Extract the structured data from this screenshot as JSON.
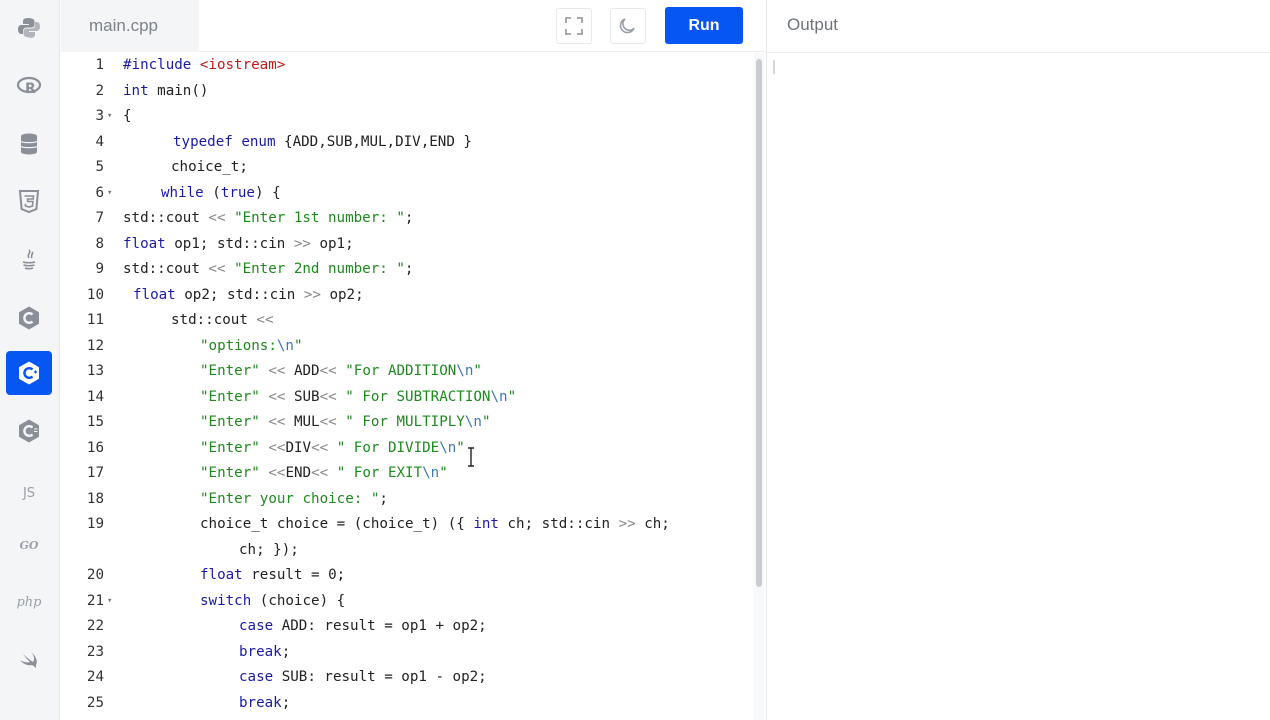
{
  "sidebar": {
    "languages": [
      {
        "name": "python",
        "icon": "python-icon"
      },
      {
        "name": "r",
        "icon": "r-icon"
      },
      {
        "name": "sql",
        "icon": "database-icon"
      },
      {
        "name": "html",
        "icon": "html5-icon"
      },
      {
        "name": "java",
        "icon": "java-icon"
      },
      {
        "name": "c",
        "icon": "c-icon"
      },
      {
        "name": "cpp",
        "icon": "cpp-icon",
        "active": true
      },
      {
        "name": "csharp",
        "icon": "csharp-icon"
      },
      {
        "name": "javascript",
        "label": "JS"
      },
      {
        "name": "go",
        "label": "GO"
      },
      {
        "name": "php",
        "label": "php"
      },
      {
        "name": "swift",
        "icon": "swift-icon"
      }
    ],
    "active_color": "#0556f3"
  },
  "editor": {
    "filename": "main.cpp",
    "run_label": "Run",
    "fullscreen_icon": "fullscreen-icon",
    "theme_icon": "moon-icon"
  },
  "output": {
    "title": "Output"
  },
  "code_lines": [
    {
      "n": "1",
      "text": "#include <iostream>"
    },
    {
      "n": "2",
      "text": "int main()"
    },
    {
      "n": "3",
      "text": "{",
      "fold": true
    },
    {
      "n": "4",
      "text": "typedef enum {ADD,SUB,MUL,DIV,END }"
    },
    {
      "n": "5",
      "text": "choice_t;"
    },
    {
      "n": "6",
      "text": "while (true) {",
      "fold": true
    },
    {
      "n": "7",
      "text": "std::cout << \"Enter 1st number: \";"
    },
    {
      "n": "8",
      "text": "float op1; std::cin >> op1;"
    },
    {
      "n": "9",
      "text": "std::cout << \"Enter 2nd number: \";"
    },
    {
      "n": "10",
      "text": "float op2; std::cin >> op2;"
    },
    {
      "n": "11",
      "text": "std::cout <<"
    },
    {
      "n": "12",
      "text": "\"options:\\n\""
    },
    {
      "n": "13",
      "text": "\"Enter\" << ADD<< \"For ADDITION\\n\""
    },
    {
      "n": "14",
      "text": "\"Enter\" << SUB<< \" For SUBTRACTION\\n\""
    },
    {
      "n": "15",
      "text": "\"Enter\" << MUL<< \" For MULTIPLY\\n\""
    },
    {
      "n": "16",
      "text": "\"Enter\" <<DIV<< \" For DIVIDE\\n\""
    },
    {
      "n": "17",
      "text": "\"Enter\" <<END<< \" For EXIT\\n\""
    },
    {
      "n": "18",
      "text": "\"Enter your choice: \";"
    },
    {
      "n": "19",
      "text": "choice_t choice = (choice_t) ({ int ch; std::cin >> ch;"
    },
    {
      "n": "",
      "text": "ch; });"
    },
    {
      "n": "20",
      "text": "float result = 0;"
    },
    {
      "n": "21",
      "text": "switch (choice) {",
      "fold": true
    },
    {
      "n": "22",
      "text": "case ADD: result = op1 + op2;"
    },
    {
      "n": "23",
      "text": "break;"
    },
    {
      "n": "24",
      "text": "case SUB: result = op1 - op2;"
    },
    {
      "n": "25",
      "text": "break;"
    }
  ]
}
